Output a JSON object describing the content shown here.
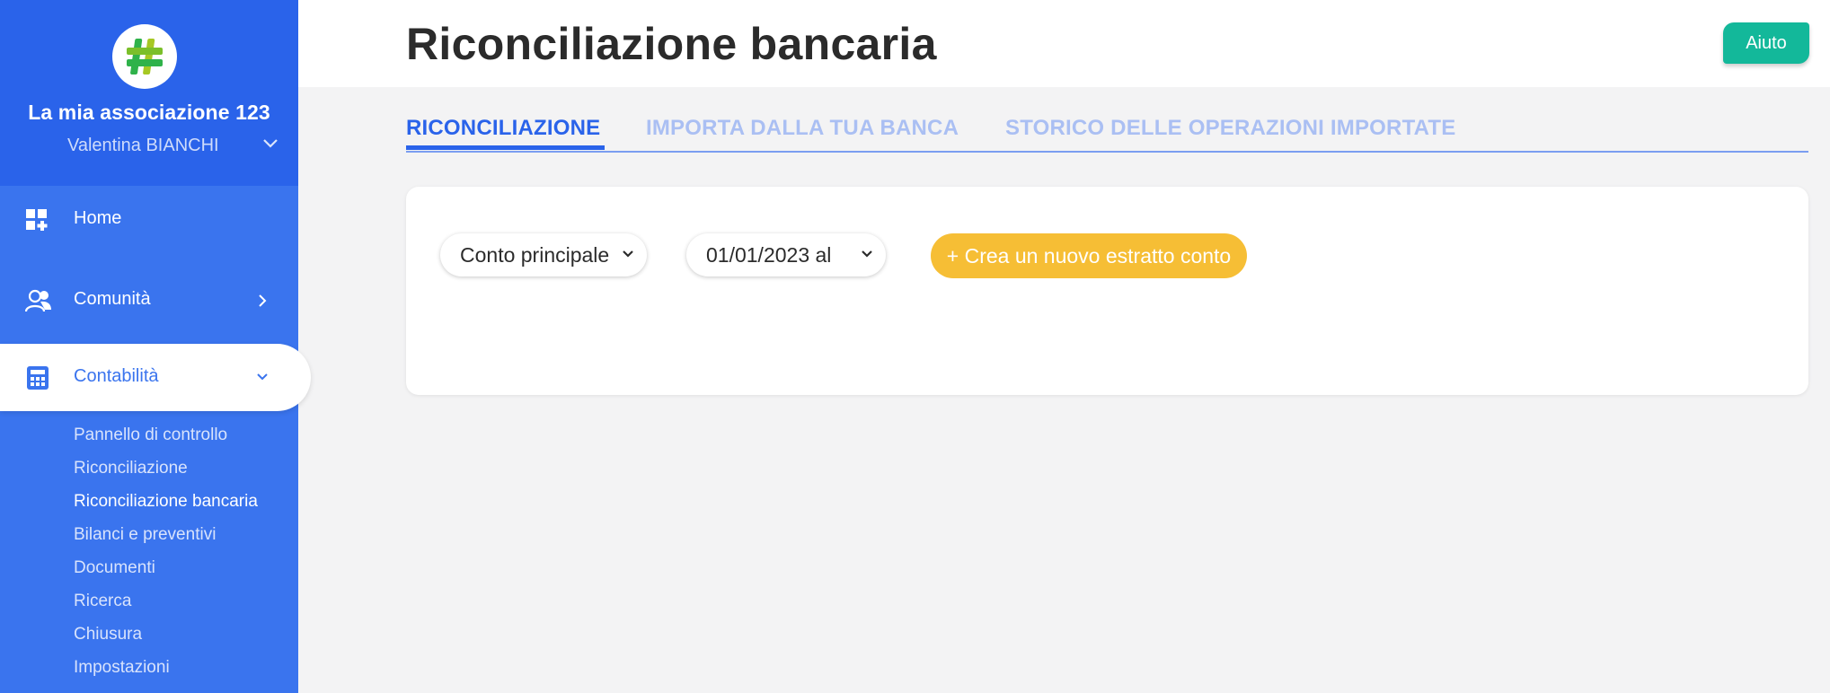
{
  "sidebar": {
    "org_name": "La mia associazione 123",
    "user_name": "Valentina BIANCHI",
    "nav": {
      "home": "Home",
      "community": "Comunità",
      "accounting": "Contabilità"
    },
    "subnav": [
      "Pannello di controllo",
      "Riconciliazione",
      "Riconciliazione bancaria",
      "Bilanci e preventivi",
      "Documenti",
      "Ricerca",
      "Chiusura",
      "Impostazioni"
    ],
    "current_subnav": "Riconciliazione bancaria"
  },
  "header": {
    "title": "Riconciliazione bancaria",
    "help_label": "Aiuto"
  },
  "tabs": [
    {
      "label": "RICONCILIAZIONE",
      "active": true
    },
    {
      "label": "IMPORTA DALLA TUA BANCA",
      "active": false
    },
    {
      "label": "STORICO DELLE OPERAZIONI IMPORTATE",
      "active": false
    }
  ],
  "filters": {
    "account_select": "Conto principale",
    "date_select": "01/01/2023 al",
    "create_button": "+ Crea un nuovo estratto conto"
  },
  "colors": {
    "sidebar": "#3a74ee",
    "sidebar_top": "#2a63ea",
    "accent": "#2a63ea",
    "help": "#13b89a",
    "create": "#f6be35"
  },
  "icons": {
    "logo": "hashtag-logo",
    "home": "dashboard-icon",
    "community": "users-icon",
    "accounting": "calculator-icon"
  }
}
